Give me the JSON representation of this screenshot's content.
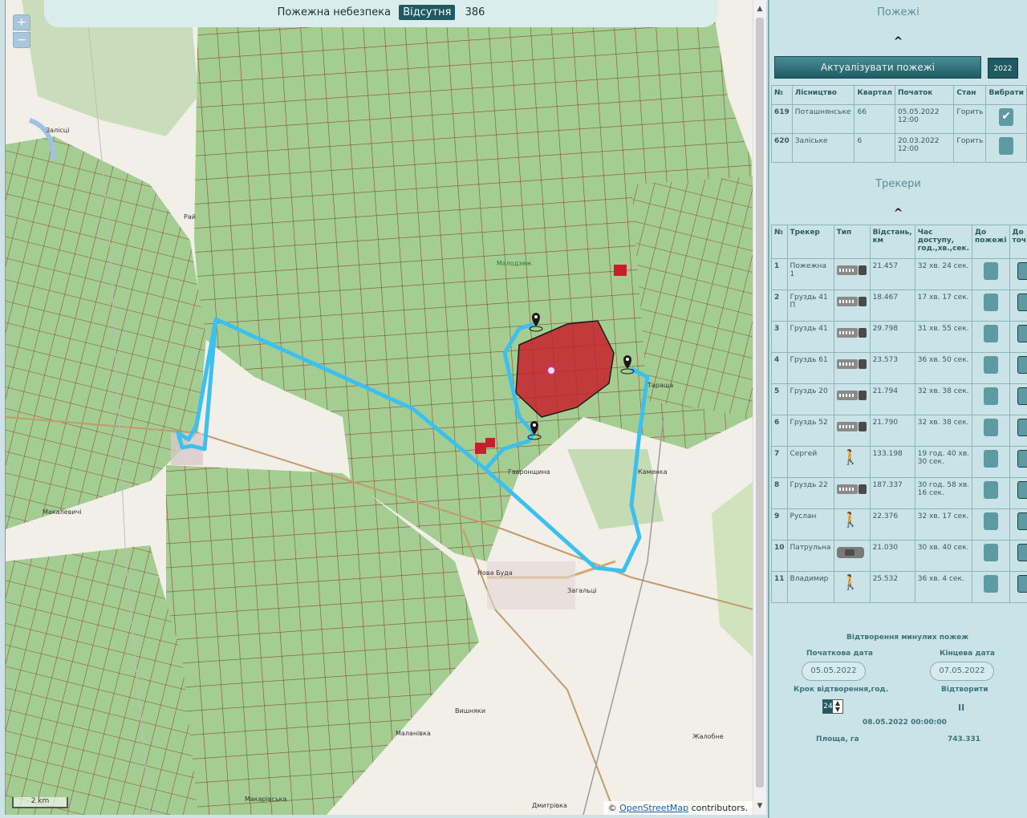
{
  "map": {
    "status_label": "Пожежна небезпека",
    "status_value": "Відсутня",
    "status_count": "386",
    "zoom_in": "+",
    "zoom_out": "−",
    "scale_label": "2 km",
    "attribution_prefix": "©",
    "attribution_link": "OpenStreetMap",
    "attribution_suffix": "contributors.",
    "place_labels": [
      "Залісці",
      "Рай",
      "Макалевичі",
      "Малодзеж",
      "Нова Буда",
      "Загальці",
      "Вишняки",
      "Маланівка",
      "Дмитрівка",
      "Каменка",
      "Тараща",
      "Макарівська",
      "Жалобне",
      "Гавронщина"
    ]
  },
  "panel": {
    "fires_title": "Пожежі",
    "chevron": "^",
    "update_button": "Актуалізувати пожежі",
    "year_button": "2022",
    "fires_table": {
      "headers": [
        "№",
        "Лісництво",
        "Квартал",
        "Початок",
        "Стан",
        "Вибрати"
      ],
      "rows": [
        {
          "num": "619",
          "forestry": "Поташнянське",
          "quarter": "66",
          "start": "05.05.2022 12:00",
          "state": "Горить",
          "selected": true
        },
        {
          "num": "620",
          "forestry": "Заліське",
          "quarter": "6",
          "start": "20.03.2022 12:00",
          "state": "Горить",
          "selected": false
        }
      ]
    },
    "trackers_title": "Трекери",
    "trackers_table": {
      "headers": [
        "№",
        "Трекер",
        "Тип",
        "Відстань, км",
        "Час доступу, год.,хв.,сек.",
        "До пожежі",
        "До точки"
      ],
      "rows": [
        {
          "num": "1",
          "name": "Пожежна 1",
          "type": "truck",
          "distance": "21.457",
          "time": "32 хв. 24 сек."
        },
        {
          "num": "2",
          "name": "Груздь 41 П",
          "type": "truck",
          "distance": "18.467",
          "time": "17 хв. 17 сек."
        },
        {
          "num": "3",
          "name": "Груздь 41",
          "type": "truck",
          "distance": "29.798",
          "time": "31 хв. 55 сек."
        },
        {
          "num": "4",
          "name": "Груздь 61",
          "type": "truck",
          "distance": "23.573",
          "time": "36 хв. 50 сек."
        },
        {
          "num": "5",
          "name": "Груздь 20",
          "type": "truck",
          "distance": "21.794",
          "time": "32 хв. 38 сек."
        },
        {
          "num": "6",
          "name": "Груздь 52",
          "type": "truck",
          "distance": "21.790",
          "time": "32 хв. 38 сек."
        },
        {
          "num": "7",
          "name": "Сергей",
          "type": "walker",
          "distance": "133.198",
          "time": "19 год. 40 хв. 30 сек."
        },
        {
          "num": "8",
          "name": "Груздь 22",
          "type": "truck",
          "distance": "187.337",
          "time": "30 год. 58 хв. 16 сек."
        },
        {
          "num": "9",
          "name": "Руслан",
          "type": "walker",
          "distance": "22.376",
          "time": "32 хв. 17 сек."
        },
        {
          "num": "10",
          "name": "Патрульна",
          "type": "car",
          "distance": "21.030",
          "time": "30 хв. 40 сек."
        },
        {
          "num": "11",
          "name": "Владимир",
          "type": "walker",
          "distance": "25.532",
          "time": "36 хв. 4 сек."
        }
      ]
    },
    "playback": {
      "title": "Відтворення минулих пожеж",
      "start_label": "Початкова дата",
      "end_label": "Кінцева дата",
      "start_value": "05.05.2022",
      "end_value": "07.05.2022",
      "step_label": "Крок відтворення,год.",
      "step_value": "24",
      "play_label": "Відтворити",
      "pause_icon": "II",
      "current_time": "08.05.2022 00:00:00",
      "area_label": "Площа, га",
      "area_value": "743.331"
    }
  },
  "colors": {
    "accent": "#1f5a63",
    "route": "#3cc0ef",
    "fire": "#c8202a",
    "forest": "#a9cf93"
  }
}
